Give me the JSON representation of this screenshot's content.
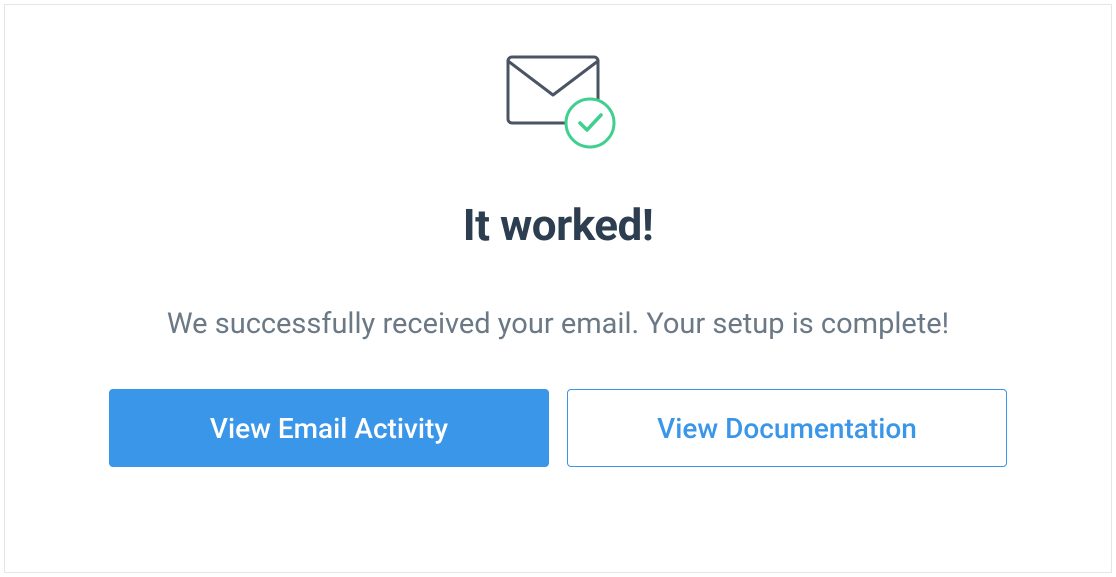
{
  "icon": {
    "envelope": "envelope-icon",
    "check": "checkmark-circle-icon"
  },
  "heading": "It worked!",
  "subtext": "We successfully received your email. Your setup is complete!",
  "buttons": {
    "primary_label": "View Email Activity",
    "secondary_label": "View Documentation"
  },
  "colors": {
    "primary": "#3a96e8",
    "success": "#3fcf8e",
    "heading": "#2c3e50",
    "body": "#6b7886"
  }
}
